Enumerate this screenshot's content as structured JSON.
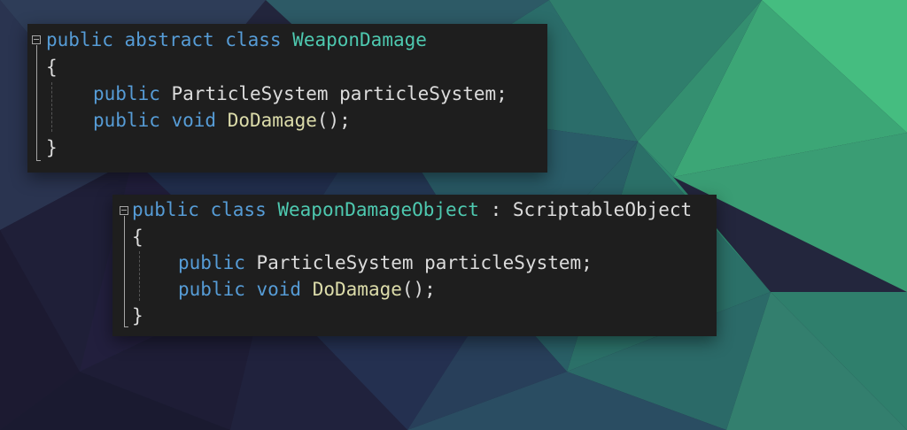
{
  "background": {
    "colors": [
      "#1c1a2e",
      "#2a3a5a",
      "#2f6e6a",
      "#3aa878",
      "#44c07f"
    ]
  },
  "theme": {
    "editor_bg": "#1e1e1e",
    "keyword": "#569cd6",
    "type": "#4ec9b0",
    "method": "#dcdcaa",
    "text": "#dcdcdc"
  },
  "snippet1": {
    "decl_kw": "public abstract class",
    "decl_name": "WeaponDamage",
    "open_brace": "{",
    "field_kw": "public",
    "field_text": "ParticleSystem particleSystem;",
    "method_kw": "public void",
    "method_name": "DoDamage",
    "method_tail": "();",
    "close_brace": "}"
  },
  "snippet2": {
    "decl_kw": "public class",
    "decl_name": "WeaponDamageObject",
    "decl_tail": ": ScriptableObject",
    "open_brace": "{",
    "field_kw": "public",
    "field_text": "ParticleSystem particleSystem;",
    "method_kw": "public void",
    "method_name": "DoDamage",
    "method_tail": "();",
    "close_brace": "}"
  }
}
